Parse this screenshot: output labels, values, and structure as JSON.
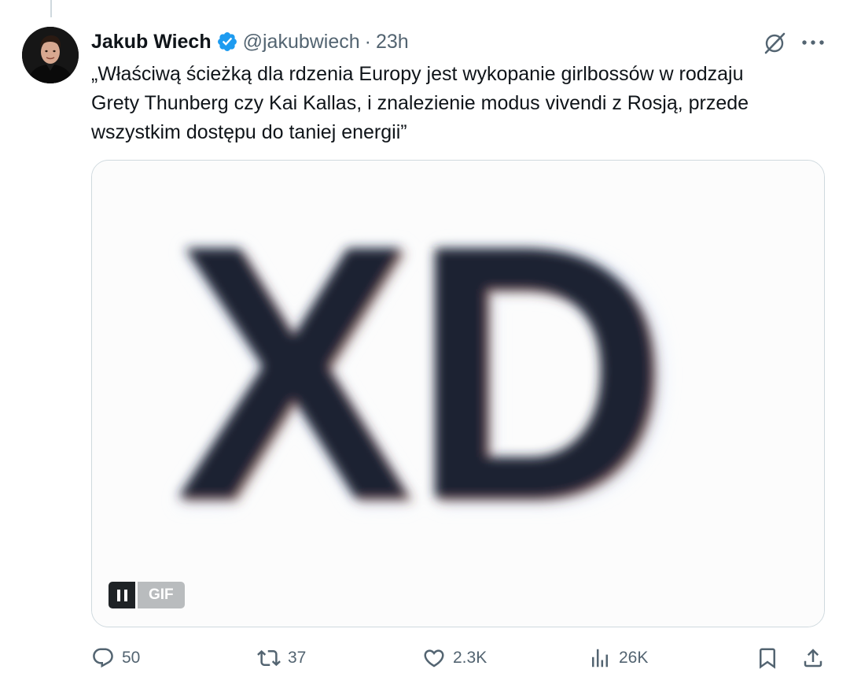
{
  "tweet": {
    "author_name": "Jakub Wiech",
    "handle": "@jakubwiech",
    "separator": "·",
    "time": "23h",
    "text": "„Właściwą ścieżką dla rdzenia Europy jest wykopanie girlbossów w rodzaju\nGrety Thunberg czy Kai Kallas, i znalezienie modus vivendi z Rosją, przede\nwszystkim dostępu do taniej energii”"
  },
  "media": {
    "gif_text": "XD",
    "badge_label": "GIF"
  },
  "actions": {
    "replies": "50",
    "reposts": "37",
    "likes": "2.3K",
    "views": "26K"
  },
  "icons": {
    "verified": "verified-badge-icon",
    "grok": "grok-icon",
    "more": "more-icon",
    "reply": "reply-icon",
    "repost": "repost-icon",
    "like": "like-icon",
    "views": "views-icon",
    "bookmark": "bookmark-icon",
    "share": "share-icon"
  },
  "colors": {
    "accent": "#1d9bf0",
    "text": "#0f1419",
    "secondary": "#536471",
    "border": "#cfd9de"
  }
}
